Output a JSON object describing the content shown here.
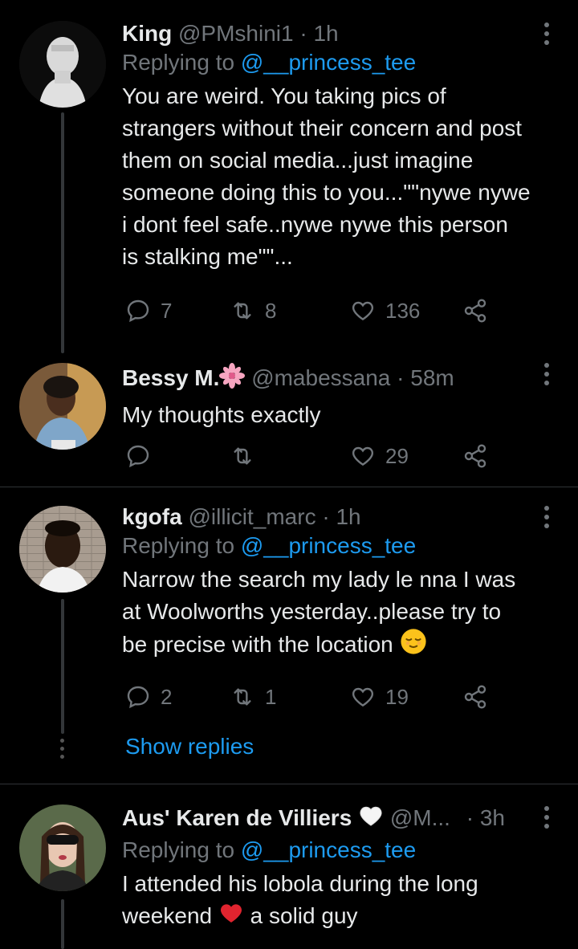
{
  "replies": [
    {
      "name": "King",
      "handle": "@PMshini1",
      "time": "1h",
      "replying_label": "Replying to",
      "replying_to": "@__princess_tee",
      "lines": [
        "You are weird. You taking pics of",
        "strangers without their concern and post",
        "them on social media...just imagine",
        "someone doing this to you...\"\"nywe nywe",
        "i dont feel safe..nywe nywe this person",
        "is stalking me\"\"..."
      ],
      "reply_count": "7",
      "retweet_count": "8",
      "like_count": "136"
    },
    {
      "name": "Bessy M.",
      "handle": "@mabessana",
      "time": "58m",
      "lines": [
        "My thoughts exactly"
      ],
      "reply_count": "",
      "retweet_count": "",
      "like_count": "29"
    },
    {
      "name": "kgofa",
      "handle": "@illicit_marc",
      "time": "1h",
      "replying_label": "Replying to",
      "replying_to": "@__princess_tee",
      "lines": [
        "Narrow the search my lady le nna I was",
        "at Woolworths yesterday..please try to",
        "be precise with the location"
      ],
      "reply_count": "2",
      "retweet_count": "1",
      "like_count": "19",
      "show_replies": "Show replies"
    },
    {
      "name": "Aus' Karen de Villiers",
      "handle": "@M...",
      "time": "3h",
      "replying_label": "Replying to",
      "replying_to": "@__princess_tee",
      "line1": "I attended his lobola during the long",
      "line2a": "weekend",
      "line2b": "a solid guy"
    }
  ],
  "colors": {
    "accent": "#1d9bf0",
    "muted": "#71767b",
    "text": "#e7e9ea",
    "background": "#000000"
  }
}
